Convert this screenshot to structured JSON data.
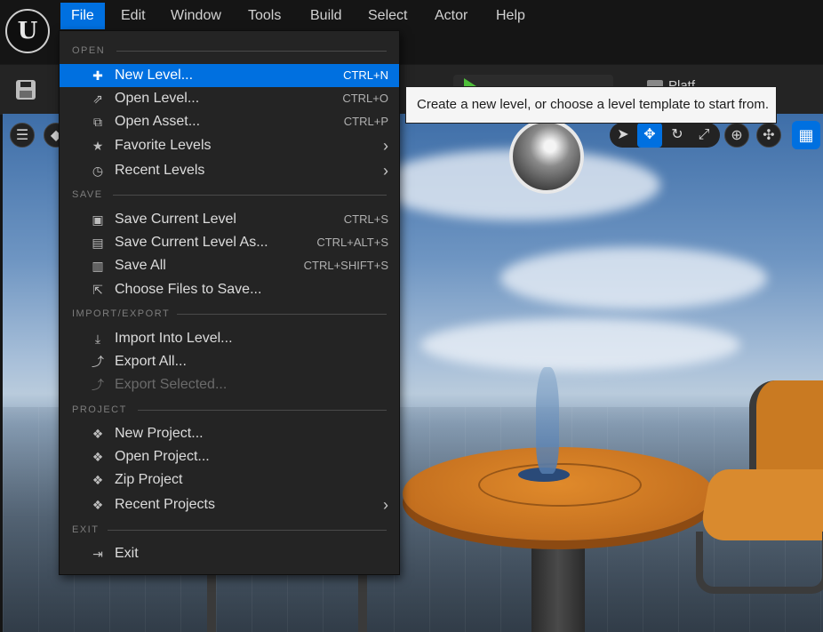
{
  "menubar": {
    "logo": "U",
    "items": [
      {
        "label": "File"
      },
      {
        "label": "Edit"
      },
      {
        "label": "Window"
      },
      {
        "label": "Tools"
      },
      {
        "label": "Build"
      },
      {
        "label": "Select"
      },
      {
        "label": "Actor"
      },
      {
        "label": "Help"
      }
    ]
  },
  "toolbar": {
    "platforms_label": "Platf"
  },
  "file_menu": {
    "sections": {
      "open": "OPEN",
      "save": "SAVE",
      "import_export": "IMPORT/EXPORT",
      "project": "PROJECT",
      "exit": "EXIT"
    },
    "items": {
      "new_level": {
        "label": "New Level...",
        "shortcut": "CTRL+N",
        "icon": "new-level-icon"
      },
      "open_level": {
        "label": "Open Level...",
        "shortcut": "CTRL+O",
        "icon": "open-level-icon"
      },
      "open_asset": {
        "label": "Open Asset...",
        "shortcut": "CTRL+P",
        "icon": "open-asset-icon"
      },
      "favorite_levels": {
        "label": "Favorite Levels",
        "icon": "favorite-levels-icon"
      },
      "recent_levels": {
        "label": "Recent Levels",
        "icon": "recent-levels-icon"
      },
      "save_current_level": {
        "label": "Save Current Level",
        "shortcut": "CTRL+S",
        "icon": "save-icon"
      },
      "save_current_level_as": {
        "label": "Save Current Level As...",
        "shortcut": "CTRL+ALT+S",
        "icon": "save-as-icon"
      },
      "save_all": {
        "label": "Save All",
        "shortcut": "CTRL+SHIFT+S",
        "icon": "save-all-icon"
      },
      "choose_files": {
        "label": "Choose Files to Save...",
        "icon": "choose-files-icon"
      },
      "import_into_level": {
        "label": "Import Into Level...",
        "icon": "import-icon"
      },
      "export_all": {
        "label": "Export All...",
        "icon": "export-icon"
      },
      "export_selected": {
        "label": "Export Selected...",
        "icon": "export-selected-icon"
      },
      "new_project": {
        "label": "New Project...",
        "icon": "new-project-icon"
      },
      "open_project": {
        "label": "Open Project...",
        "icon": "open-project-icon"
      },
      "zip_project": {
        "label": "Zip Project",
        "icon": "zip-project-icon"
      },
      "recent_projects": {
        "label": "Recent Projects",
        "icon": "recent-projects-icon"
      },
      "exit": {
        "label": "Exit",
        "icon": "exit-icon"
      }
    }
  },
  "tooltip": {
    "text": "Create a new level, or choose a level template to start from."
  },
  "colors": {
    "accent": "#0070e0",
    "menu_bg": "#242424",
    "bar_bg": "#151515"
  }
}
